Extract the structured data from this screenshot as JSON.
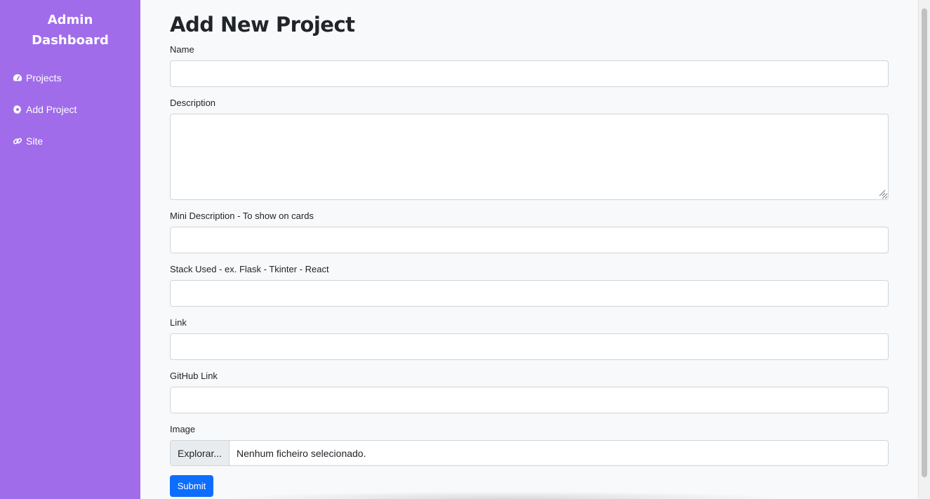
{
  "sidebar": {
    "brand": "Admin Dashboard",
    "brand_line1": "Admin",
    "brand_line2": "Dashboard",
    "items": [
      {
        "label": "Projects",
        "icon": "dashboard-icon"
      },
      {
        "label": "Add Project",
        "icon": "gear-icon"
      },
      {
        "label": "Site",
        "icon": "link-icon"
      }
    ]
  },
  "page": {
    "title": "Add New Project"
  },
  "form": {
    "name_label": "Name",
    "name_value": "",
    "description_label": "Description",
    "description_value": "",
    "mini_description_label": "Mini Description - To show on cards",
    "mini_description_value": "",
    "stack_label": "Stack Used - ex. Flask - Tkinter - React",
    "stack_value": "",
    "link_label": "Link",
    "link_value": "",
    "github_label": "GitHub Link",
    "github_value": "",
    "image_label": "Image",
    "file_button_label": "Explorar...",
    "file_status": "Nenhum ficheiro selecionado.",
    "submit_label": "Submit"
  },
  "colors": {
    "sidebar_bg": "#a06cea",
    "primary": "#0d6efd",
    "page_bg": "#f8f9fa"
  }
}
